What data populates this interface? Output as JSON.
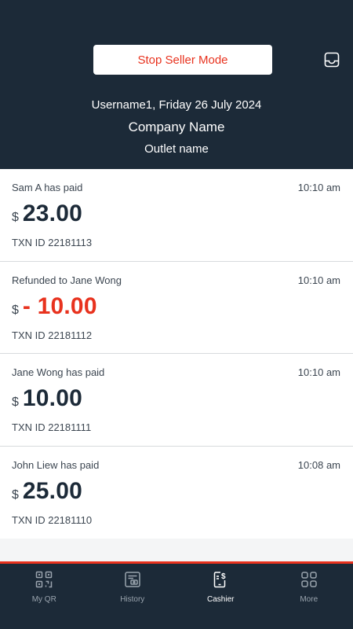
{
  "header": {
    "stop_label": "Stop Seller Mode",
    "line1": "Username1, Friday 26 July 2024",
    "company": "Company Name",
    "outlet": "Outlet name",
    "icons": {
      "inbox": "inbox-icon"
    }
  },
  "transactions": [
    {
      "description": "Sam A has paid",
      "time": "10:10 am",
      "currency": "$",
      "amount": "23.00",
      "txn_id": "TXN ID 22181113"
    },
    {
      "description": "Refunded to Jane Wong",
      "time": "10:10 am",
      "currency": "$",
      "amount": "- 10.00",
      "txn_id": "TXN ID 22181112"
    },
    {
      "description": "Jane Wong has paid",
      "time": "10:10 am",
      "currency": "$",
      "amount": "10.00",
      "txn_id": "TXN ID 22181111"
    },
    {
      "description": "John Liew has paid",
      "time": "10:08 am",
      "currency": "$",
      "amount": "25.00",
      "txn_id": "TXN ID 22181110"
    }
  ],
  "tabbar": {
    "tabs": [
      {
        "label": "My QR",
        "icon": "qr-icon"
      },
      {
        "label": "History",
        "icon": "history-icon"
      },
      {
        "label": "Cashier",
        "icon": "cashier-icon"
      },
      {
        "label": "More",
        "icon": "more-grid-icon"
      }
    ],
    "active": "Cashier"
  },
  "colors": {
    "header_bg": "#1c2a38",
    "accent_red": "#e8321e",
    "text_dark": "#1c2a38",
    "text_muted": "#3c4651",
    "tab_inactive": "#9aa4ae"
  }
}
